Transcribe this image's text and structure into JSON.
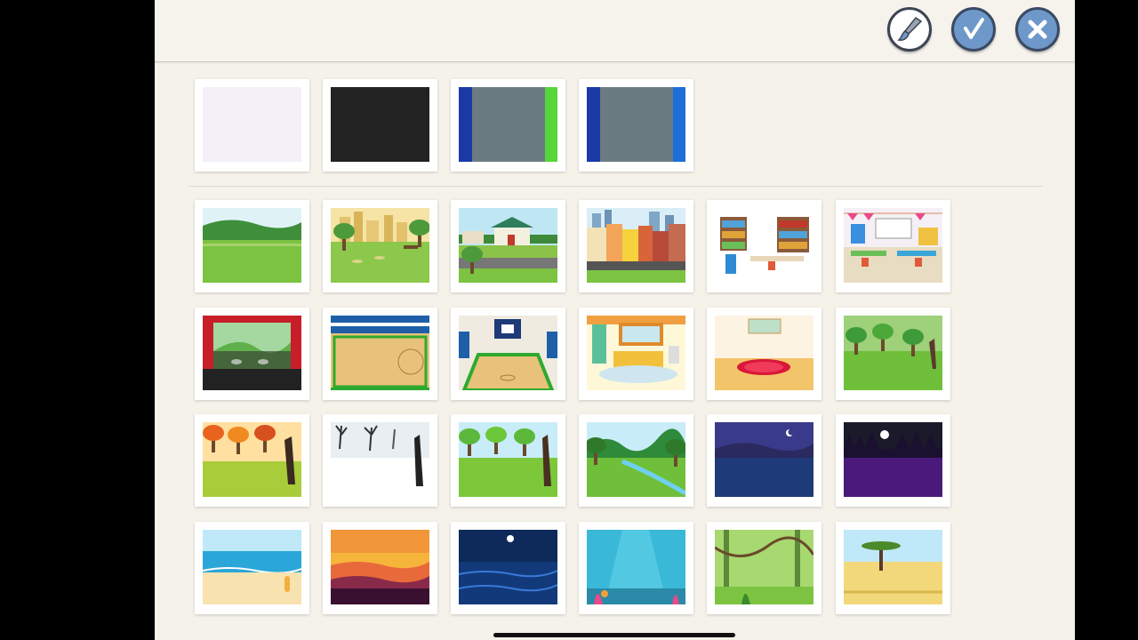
{
  "toolbar": {
    "buttons": [
      {
        "name": "paintbrush-button",
        "icon": "paintbrush-icon"
      },
      {
        "name": "confirm-button",
        "icon": "checkmark-icon"
      },
      {
        "name": "close-button",
        "icon": "close-icon"
      }
    ]
  },
  "colors": {
    "panel": "#f5f2ea",
    "button_blue": "#6e98c9",
    "button_border": "#3a4a63"
  },
  "solid_backgrounds": [
    {
      "name": "bg-white",
      "kind": "white"
    },
    {
      "name": "bg-black",
      "kind": "black"
    },
    {
      "name": "bg-green-screen",
      "kind": "greenscreen"
    },
    {
      "name": "bg-blue-screen",
      "kind": "bluescreen"
    }
  ],
  "scene_backgrounds": [
    {
      "name": "bg-meadow",
      "kind": "meadow"
    },
    {
      "name": "bg-city-park",
      "kind": "citypark"
    },
    {
      "name": "bg-suburb-street",
      "kind": "suburb"
    },
    {
      "name": "bg-city-street",
      "kind": "citystreet"
    },
    {
      "name": "bg-library",
      "kind": "library"
    },
    {
      "name": "bg-classroom",
      "kind": "classroom"
    },
    {
      "name": "bg-theater-stage",
      "kind": "theater"
    },
    {
      "name": "bg-basketball-court-top",
      "kind": "courttop"
    },
    {
      "name": "bg-basketball-court",
      "kind": "court"
    },
    {
      "name": "bg-bedroom",
      "kind": "bedroom"
    },
    {
      "name": "bg-empty-room",
      "kind": "room"
    },
    {
      "name": "bg-summer-forest",
      "kind": "forest"
    },
    {
      "name": "bg-autumn-forest",
      "kind": "autumn"
    },
    {
      "name": "bg-winter-forest",
      "kind": "winter"
    },
    {
      "name": "bg-spring-forest",
      "kind": "spring"
    },
    {
      "name": "bg-river-valley",
      "kind": "river"
    },
    {
      "name": "bg-night-lake",
      "kind": "nightlake"
    },
    {
      "name": "bg-night-forest",
      "kind": "nightforest"
    },
    {
      "name": "bg-beach",
      "kind": "beach"
    },
    {
      "name": "bg-sunset-sea",
      "kind": "sunset"
    },
    {
      "name": "bg-night-ocean",
      "kind": "nightocean"
    },
    {
      "name": "bg-underwater",
      "kind": "underwater"
    },
    {
      "name": "bg-jungle",
      "kind": "jungle"
    },
    {
      "name": "bg-savanna",
      "kind": "savanna"
    }
  ]
}
